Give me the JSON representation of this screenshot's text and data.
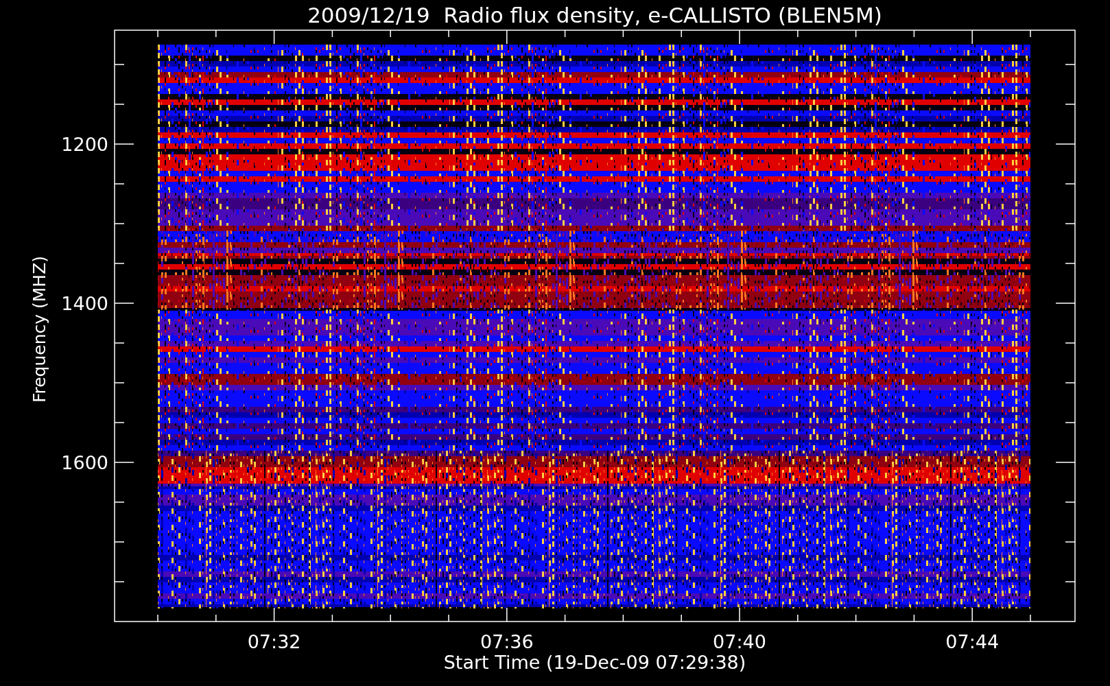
{
  "title": "2009/12/19  Radio flux density, e-CALLISTO (BLEN5M)",
  "y_axis": {
    "label": "Frequency (MHZ)",
    "tick_labels": [
      "1200",
      "1400",
      "1600"
    ]
  },
  "x_axis": {
    "label": "Start Time (19-Dec-09 07:29:38)",
    "tick_labels": [
      "07:32",
      "07:36",
      "07:40",
      "07:44"
    ]
  }
}
